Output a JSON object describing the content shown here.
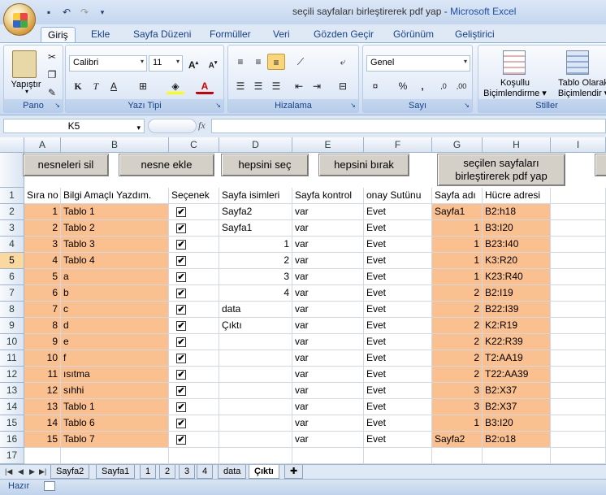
{
  "window": {
    "title": "seçili sayfaları birleştirerek pdf yap",
    "app": "Microsoft Excel",
    "sep": " - "
  },
  "tabs": [
    "Giriş",
    "Ekle",
    "Sayfa Düzeni",
    "Formüller",
    "Veri",
    "Gözden Geçir",
    "Görünüm",
    "Geliştirici"
  ],
  "ribbon": {
    "clipboard": {
      "paste": "Yapıştır",
      "label": "Pano"
    },
    "font": {
      "name": "Calibri",
      "size": "11",
      "label": "Yazı Tipi"
    },
    "alignment": {
      "label": "Hizalama"
    },
    "number": {
      "format": "Genel",
      "label": "Sayı"
    },
    "styles": {
      "conditional1": "Koşullu",
      "conditional2": "Biçimlendirme",
      "table1": "Tablo Olarak",
      "table2": "Biçimlendir",
      "label": "Stiller"
    }
  },
  "formula_bar": {
    "name_box": "K5",
    "fx": "fx",
    "value": ""
  },
  "columns": [
    "A",
    "B",
    "C",
    "D",
    "E",
    "F",
    "G",
    "H",
    "I"
  ],
  "buttons": {
    "delete": "nesneleri sil",
    "add": "nesne ekle",
    "select_all": "hepsini seç",
    "deselect_all": "hepsini bırak",
    "merge1": "seçilen sayfaları",
    "merge2": "birleştirerek pdf yap"
  },
  "headers": [
    "Sıra no",
    "Bilgi Amaçlı Yazdım.",
    "Seçenek",
    "Sayfa isimleri",
    "Sayfa kontrol",
    "onay Sutünu",
    "Sayfa adı",
    "Hücre adresi"
  ],
  "rows": [
    {
      "n": "1",
      "b": "Tablo 1",
      "d": "Sayfa2",
      "e": "var",
      "f": "Evet",
      "g": "Sayfa1",
      "h": "B2:h18"
    },
    {
      "n": "2",
      "b": "Tablo 2",
      "d": "Sayfa1",
      "e": "var",
      "f": "Evet",
      "g": "1",
      "h": "B3:I20"
    },
    {
      "n": "3",
      "b": "Tablo 3",
      "d": "1",
      "e": "var",
      "f": "Evet",
      "g": "1",
      "h": "B23:I40"
    },
    {
      "n": "4",
      "b": "Tablo 4",
      "d": "2",
      "e": "var",
      "f": "Evet",
      "g": "1",
      "h": "K3:R20"
    },
    {
      "n": "5",
      "b": "a",
      "d": "3",
      "e": "var",
      "f": "Evet",
      "g": "1",
      "h": "K23:R40"
    },
    {
      "n": "6",
      "b": "b",
      "d": "4",
      "e": "var",
      "f": "Evet",
      "g": "2",
      "h": "B2:I19"
    },
    {
      "n": "7",
      "b": "c",
      "d": "data",
      "e": "var",
      "f": "Evet",
      "g": "2",
      "h": "B22:I39"
    },
    {
      "n": "8",
      "b": "d",
      "d": "Çıktı",
      "e": "var",
      "f": "Evet",
      "g": "2",
      "h": "K2:R19"
    },
    {
      "n": "9",
      "b": "e",
      "d": "",
      "e": "var",
      "f": "Evet",
      "g": "2",
      "h": "K22:R39"
    },
    {
      "n": "10",
      "b": "f",
      "d": "",
      "e": "var",
      "f": "Evet",
      "g": "2",
      "h": "T2:AA19"
    },
    {
      "n": "11",
      "b": "ısıtma",
      "d": "",
      "e": "var",
      "f": "Evet",
      "g": "2",
      "h": "T22:AA39"
    },
    {
      "n": "12",
      "b": "sıhhi",
      "d": "",
      "e": "var",
      "f": "Evet",
      "g": "3",
      "h": "B2:X37"
    },
    {
      "n": "13",
      "b": "Tablo 1",
      "d": "",
      "e": "var",
      "f": "Evet",
      "g": "3",
      "h": "B2:X37"
    },
    {
      "n": "14",
      "b": "Tablo 6",
      "d": "",
      "e": "var",
      "f": "Evet",
      "g": "1",
      "h": "B3:I20"
    },
    {
      "n": "15",
      "b": "Tablo 7",
      "d": "",
      "e": "var",
      "f": "Evet",
      "g": "Sayfa2",
      "h": "B2:o18"
    }
  ],
  "row_numbers": [
    "1",
    "2",
    "3",
    "4",
    "5",
    "6",
    "7",
    "8",
    "9",
    "10",
    "11",
    "12",
    "13",
    "14",
    "15",
    "16",
    "17"
  ],
  "sheet_tabs": [
    "Sayfa2",
    "Sayfa1",
    "1",
    "2",
    "3",
    "4",
    "data",
    "Çıktı"
  ],
  "active_sheet": "Çıktı",
  "status": "Hazır",
  "check_mark": "✔"
}
